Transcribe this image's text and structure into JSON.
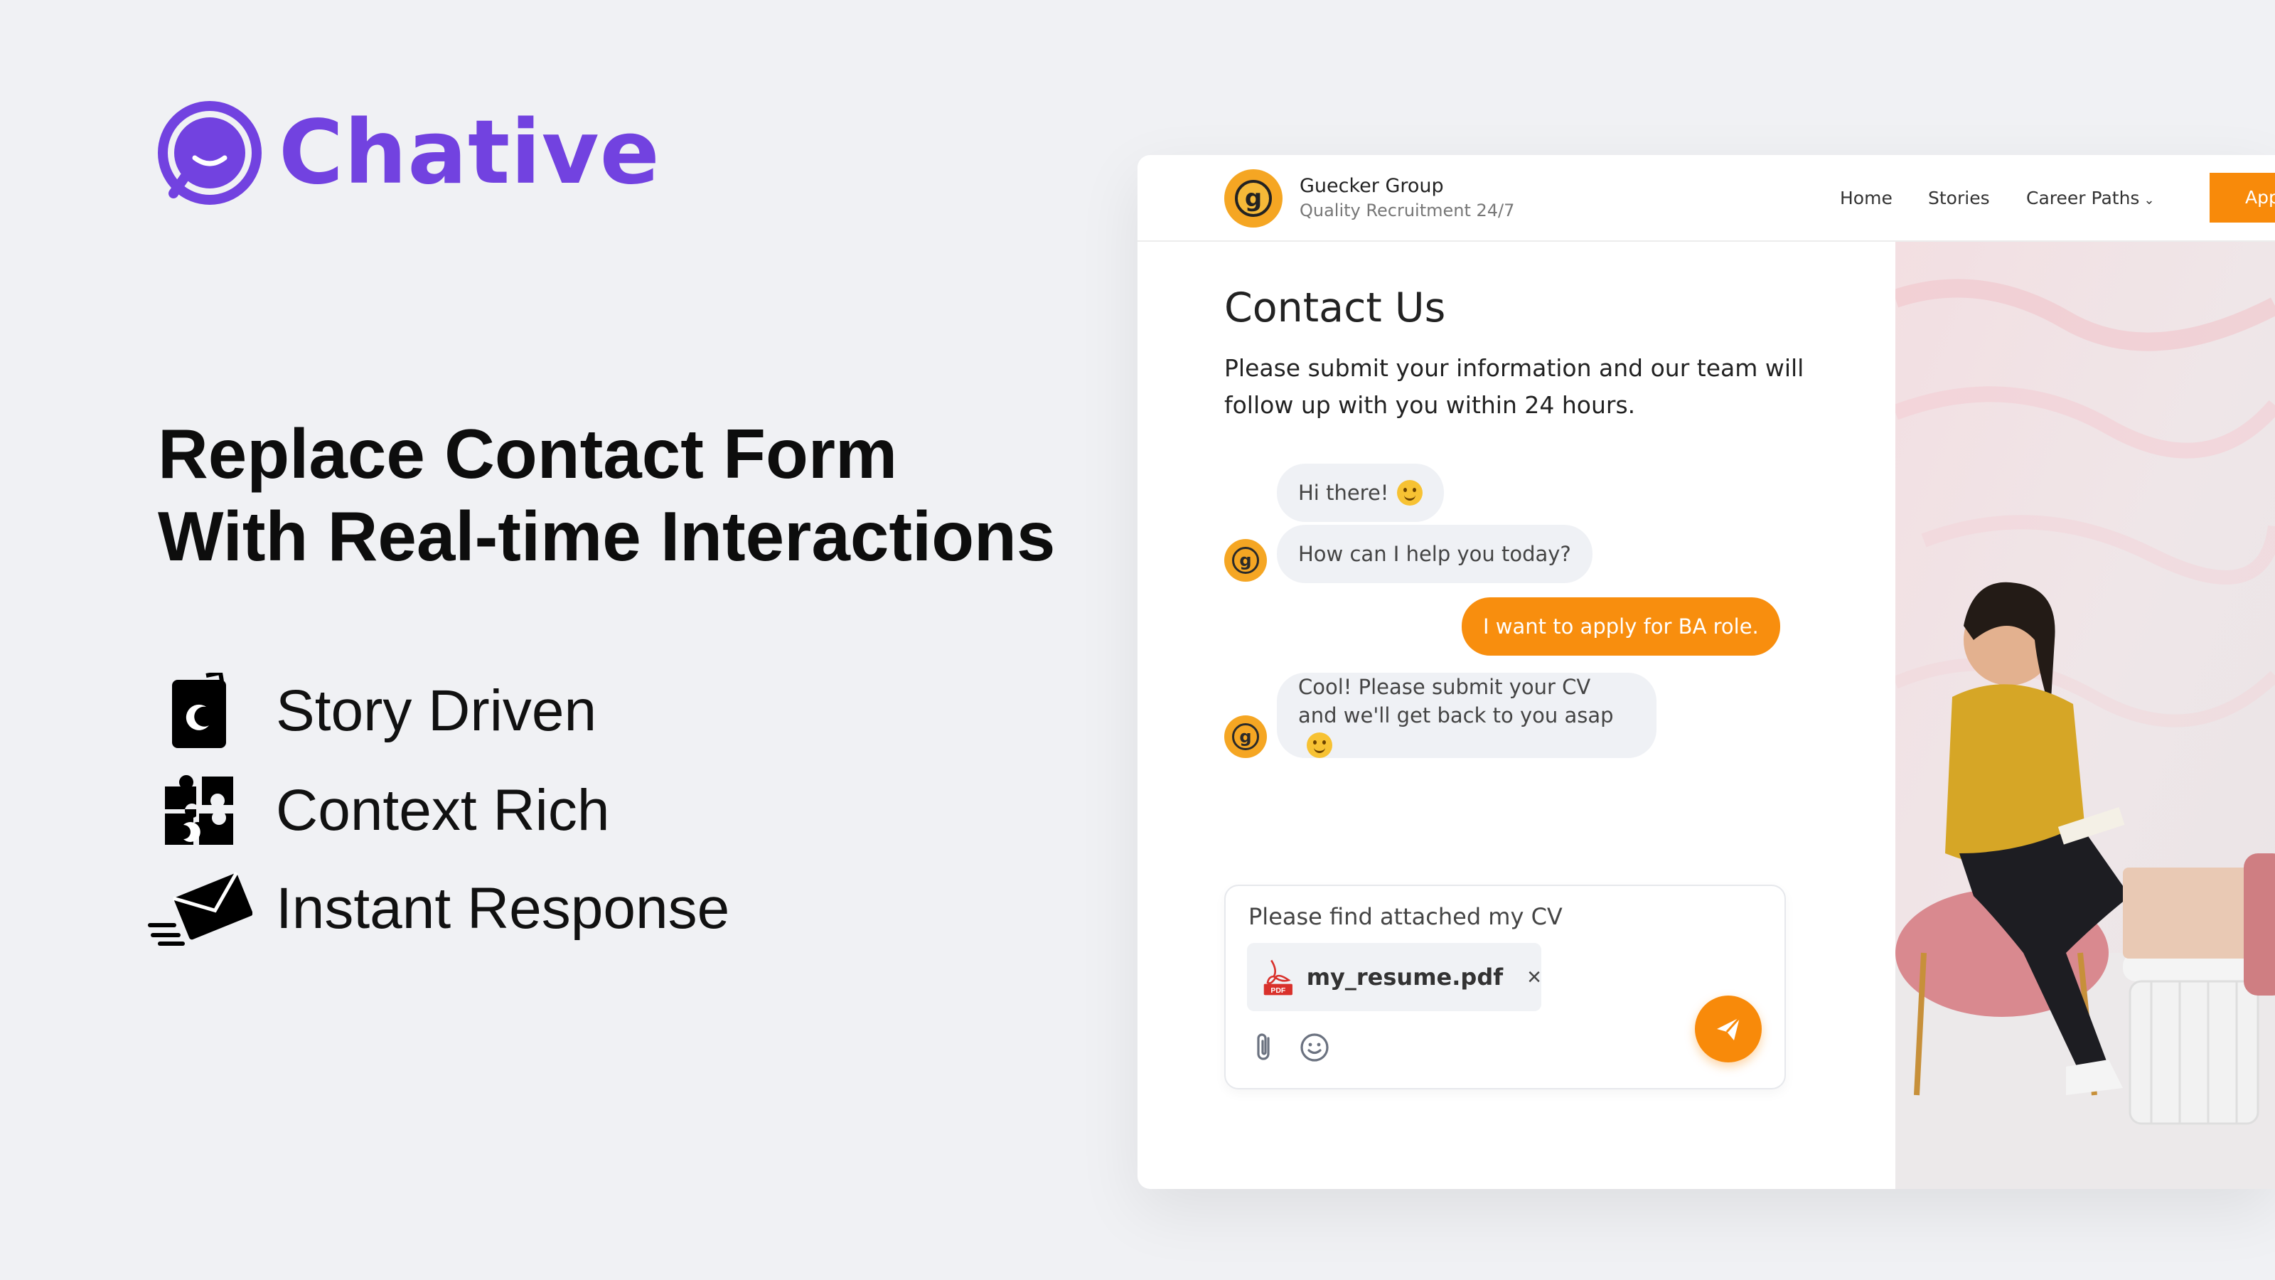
{
  "brand": {
    "name": "Chative",
    "color": "#7242e0"
  },
  "headline": {
    "line1": "Replace Contact Form",
    "line2": "With Real-time Interactions"
  },
  "features": [
    {
      "icon": "book-moon-icon",
      "label": "Story Driven"
    },
    {
      "icon": "puzzle-icon",
      "label": "Context Rich"
    },
    {
      "icon": "fast-envelope-icon",
      "label": "Instant Response"
    }
  ],
  "site": {
    "name": "Guecker Group",
    "tagline": "Quality Recruitment 24/7",
    "logo_letter": "g",
    "nav": {
      "home": "Home",
      "stories": "Stories",
      "career": "Career Paths"
    },
    "cta_partial": "App",
    "accent": "#f88a0a"
  },
  "contact": {
    "title": "Contact Us",
    "description": "Please submit your information and our team will follow up with you within 24 hours."
  },
  "chat": {
    "messages": [
      {
        "from": "agent",
        "text": "Hi there!",
        "emoji": "smiling-face"
      },
      {
        "from": "agent",
        "text": "How can I help you today?"
      },
      {
        "from": "user",
        "text": "I want to apply for BA role."
      },
      {
        "from": "agent",
        "text": "Cool! Please submit your CV and we'll get back to you asap",
        "emoji": "star-struck-face"
      }
    ]
  },
  "composer": {
    "text": "Please find attached my CV",
    "attachment": {
      "name": "my_resume.pdf",
      "type_label": "PDF",
      "remove": "×"
    }
  }
}
